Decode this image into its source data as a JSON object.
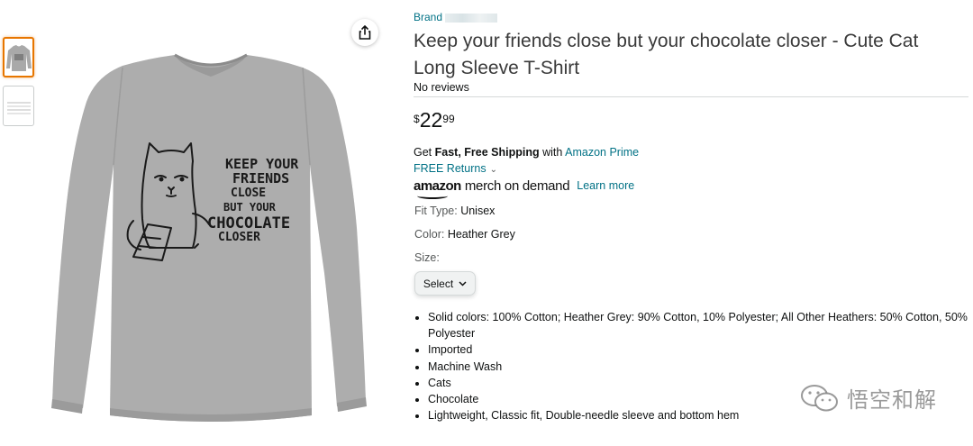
{
  "thumbnails": [
    {
      "name": "thumbnail-shirt",
      "active": true
    },
    {
      "name": "thumbnail-size-chart",
      "active": false
    }
  ],
  "image": {
    "shirt_color": "#a9a9a9",
    "print_lines": [
      "KEEP YOUR",
      "FRIENDS",
      "CLOSE",
      "BUT YOUR",
      "CHOCOLATE",
      "CLOSER"
    ]
  },
  "product": {
    "brand_label": "Brand",
    "title": "Keep your friends close but your chocolate closer - Cute Cat Long Sleeve T-Shirt",
    "reviews": "No reviews",
    "price": {
      "symbol": "$",
      "whole": "22",
      "fraction": "99"
    },
    "shipping": {
      "prefix": "Get ",
      "bold": "Fast, Free Shipping",
      "mid": " with ",
      "link": "Amazon Prime"
    },
    "returns": "FREE Returns",
    "merch": {
      "amazon": "amazon",
      "text": "merch on demand",
      "learn_more": "Learn more"
    },
    "fit_type": {
      "label": "Fit Type:",
      "value": "Unisex"
    },
    "color": {
      "label": "Color:",
      "value": "Heather Grey"
    },
    "size": {
      "label": "Size:",
      "select": "Select"
    },
    "bullets": [
      "Solid colors: 100% Cotton; Heather Grey: 90% Cotton, 10% Polyester; All Other Heathers: 50% Cotton, 50% Polyester",
      "Imported",
      "Machine Wash",
      "Cats",
      "Chocolate",
      "Lightweight, Classic fit, Double-needle sleeve and bottom hem"
    ]
  },
  "watermark": {
    "text": "悟空和解"
  },
  "colors": {
    "link": "#007185",
    "active_thumb": "#e77600",
    "text": "#0f1111"
  }
}
